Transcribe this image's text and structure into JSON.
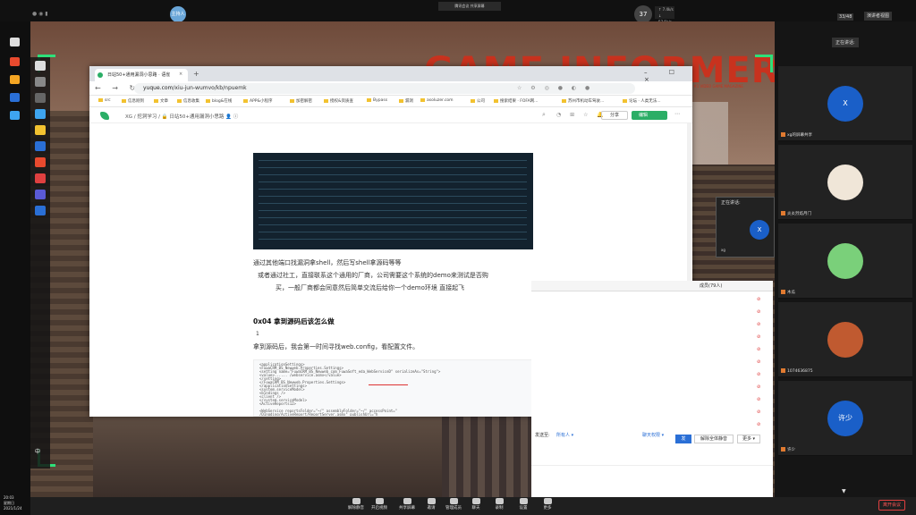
{
  "meeting": {
    "title": "腾讯会议 共享屏幕",
    "host_bubble": "主持人",
    "speaker_count": "37",
    "speaker_rate_up": "↑ 7.4k/s",
    "speaker_rate_down": "↓ 57.5k/s",
    "page_count": "33/48",
    "layout_button": "演讲者视图",
    "now_speaking": "正在讲话:",
    "popup_label": "正在讲话:",
    "popup_avatar": "X",
    "popup_name": "xg",
    "leave": "离开会议"
  },
  "participants": [
    {
      "avatar": "X",
      "name": "xg的屏幕共享",
      "color": "#1a5fc8"
    },
    {
      "avatar": "",
      "name": "炎炎烈焰月门",
      "color": "#f0e6d8"
    },
    {
      "avatar": "",
      "name": "木瓜",
      "color": "#7ad07a"
    },
    {
      "avatar": "",
      "name": "1074636875",
      "color": "#c05a30"
    },
    {
      "avatar": "许少",
      "name": "许少",
      "color": "#1a5fc8"
    }
  ],
  "bottom_toolbar": [
    "解除静音",
    "开启视频",
    "共享屏幕",
    "邀请",
    "管理成员",
    "聊天",
    "录制",
    "设置",
    "更多"
  ],
  "taskbar": {
    "lang": "中",
    "time": "20:03",
    "weekday": "星期日",
    "date": "2021/1/24"
  },
  "browser": {
    "tab_title": "日站50+通用漏洞小思路 · 语雀",
    "tab_close": "×",
    "new_tab": "+",
    "window_controls": "– ☐ ×",
    "nav": "← → ↻",
    "url_host": "yuque.com",
    "url_path": "/xiu-jun-wumvo/kb/npuemk",
    "bookmarks": [
      "src",
      "信息刚到",
      "文章",
      "信息收集",
      "blog&在线",
      "APP&小程序",
      "加密解密",
      "授权&资质查",
      "Bypass",
      "漏洞",
      "asoluzer.com",
      "公司",
      "搜索结果 · FOFA网...",
      "苏州市机动车驾驶...",
      "论坛 · 人类无法..."
    ],
    "extension_icons": "☆ ⚙ ◎ ● ◐ ●"
  },
  "yuque": {
    "breadcrumb": "XG  /  挖洞学习  /  🔒 日站50+通用漏洞小思路  👤  ⓘ",
    "search_icon": "⌕",
    "icons": "◔ ⊞ ☆ 🔔",
    "share": "分享",
    "edit": "编辑",
    "more": "⋯"
  },
  "doc": {
    "p1": "通过其他端口找漏洞拿shell，然后写shell拿源码等等",
    "p2": "或者通过社工，直接联系这个通用的厂商，公司需要这个系统的demo来测试是否购",
    "p3": "买，一般厂商都会同意然后简单交流后给你一个demo环境  直接起飞",
    "heading": "0x04 拿到源码后该怎么做",
    "num": "1",
    "p4": "拿到源码后，我会第一时间寻找web.config，看配置文件。",
    "code": [
      "<applicationSettings>",
      "  <FuwaCRM_BS_Newweb.Properties.Settings>",
      "    <setting name=\"FuwaCRM_BS_Newweb_com_FuwaSoft_eda_WebServiceD\" serializeAs=\"String\">",
      "      <value>......          /webservice.asmx</value>",
      "    </setting>",
      "  </FuwaCRM_BS_Newweb.Properties.Settings>",
      "</applicationSettings>",
      "<system.serviceModel>",
      "  <bindings />",
      "  <client />",
      "</system.serviceModel>",
      "<ActiveReports12>",
      "",
      "  <WebService reportsFolder=\"~/\" assemblyFolder=\"~/\" accessPoint=\"",
      "    /DIngding/ActiveReport/ReportServer.asmx\" publishUrl=\"h"
    ],
    "side_tools": [
      "T",
      "⊞"
    ]
  },
  "chat": {
    "header": "成员(79人)",
    "send_to_label": "发送至:",
    "send_to": "所有人 ▾",
    "permission": "聊天权限 ▾",
    "btn1": "发",
    "btn2": "解除全体静音",
    "btn3": "更多 ▾",
    "marks": [
      "⊘",
      "⊘",
      "⊘",
      "⊘",
      "⊘",
      "⊘",
      "⊘",
      "⊘",
      "⊘",
      "⊘",
      "⊘"
    ]
  },
  "colors": {
    "accent_green": "#2ee07a",
    "yuque_green": "#2bae66",
    "link_blue": "#2a6fd6",
    "leave_red": "#e04040"
  }
}
